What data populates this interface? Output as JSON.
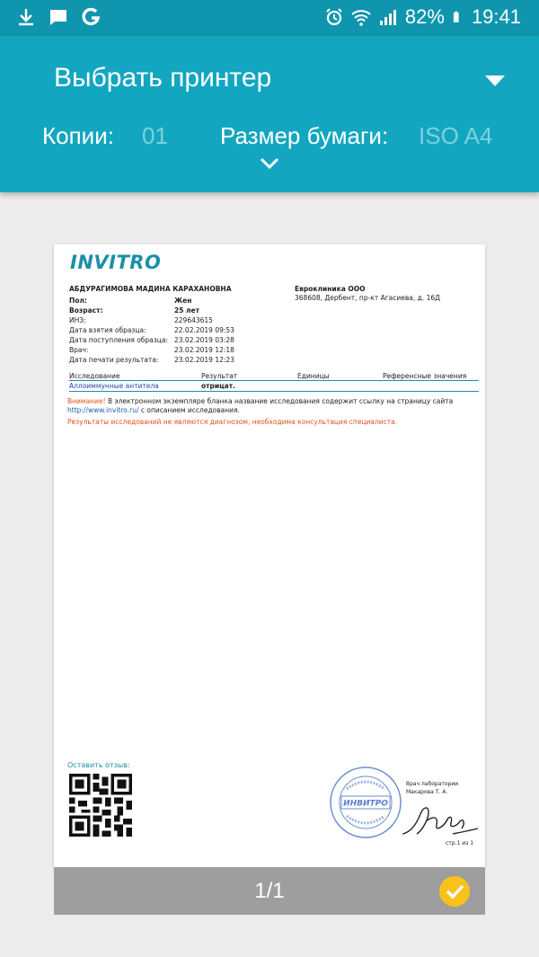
{
  "status_bar": {
    "battery_text": "82%",
    "time": "19:41",
    "icons": [
      "download-icon",
      "message-icon",
      "g-app-icon",
      "alarm-icon",
      "wifi-icon",
      "signal-icon",
      "battery-icon"
    ]
  },
  "header": {
    "printer_title": "Выбрать принтер",
    "copies_label": "Копии:",
    "copies_value": "01",
    "paper_size_label": "Размер бумаги:",
    "paper_size_value": "ISO A4"
  },
  "document": {
    "logo": "INVITRO",
    "patient_name": "АБДУРАГИМОВА МАДИНА КАРАХАНОВНА",
    "clinic_name": "Евроклиника ООО",
    "clinic_address": "368608, Дербент, пр-кт Агасиева, д. 16Д",
    "info": [
      {
        "label": "Пол:",
        "value": "Жен"
      },
      {
        "label": "Возраст:",
        "value": "25 лет"
      },
      {
        "label": "ИНЗ:",
        "value": "229643615"
      },
      {
        "label": "Дата взятия образца:",
        "value": "22.02.2019 09:53"
      },
      {
        "label": "Дата поступления образца:",
        "value": "23.02.2019 03:28"
      },
      {
        "label": "Врач:",
        "value": "23.02.2019 12:18"
      },
      {
        "label": "Дата печати результата:",
        "value": "23.02.2019 12:23"
      }
    ],
    "table_headers": {
      "test": "Исследование",
      "result": "Результат",
      "units": "Единицы",
      "reference": "Референсные значения"
    },
    "table_row": {
      "test": "Аллоиммунные антитела",
      "result": "отрицат."
    },
    "notice_label": "Внимание!",
    "notice_text": " В электронном экземпляре бланка название исследования содержит ссылку на страницу сайта",
    "notice_link": "http://www.invitro.ru/",
    "notice_text2": " с описанием исследования.",
    "disclaimer": "Результаты исследований не являются диагнозом, необходима консультация специалиста.",
    "feedback_label": "Оставить отзыв:",
    "stamp_text": "ИНВИТРО",
    "doctor_title": "Врач лаборатории",
    "doctor_name": "Макарова Т. А.",
    "page_small": "стр.1 из 1"
  },
  "footer": {
    "page_counter": "1/1"
  },
  "colors": {
    "status_bar": "#0f95ad",
    "header": "#13a6c0",
    "accent_teal": "#1b8fa8",
    "warning_orange": "#e0521c",
    "selected_yellow": "#f7c31b"
  }
}
